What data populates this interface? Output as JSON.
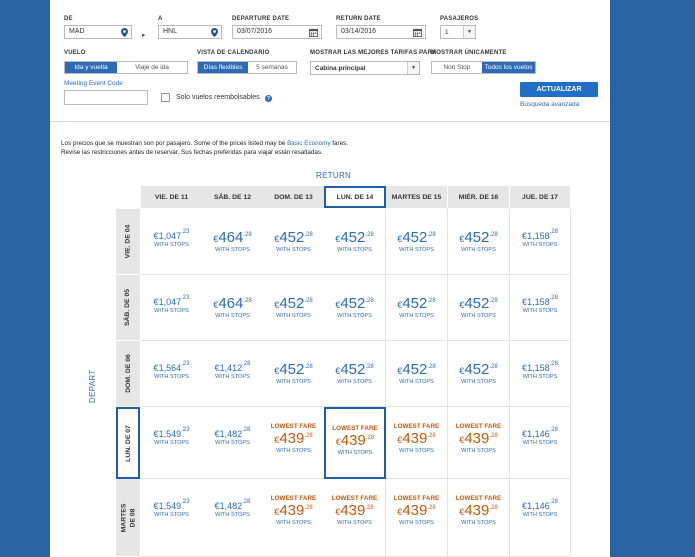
{
  "search": {
    "from_label": "DE",
    "from_value": "MAD",
    "to_label": "A",
    "to_value": "HNL",
    "depart_label": "DEPARTURE DATE",
    "depart_value": "03/07/2016",
    "return_label": "RETURN DATE",
    "return_value": "03/14/2016",
    "pax_label": "PASAJEROS",
    "pax_value": "1",
    "flight_label": "VUELO",
    "flight_opt1": "Ida y vuelta",
    "flight_opt2": "Viaje de ida",
    "calview_label": "VISTA DE CALENDARIO",
    "calview_opt1": "Días flexibles",
    "calview_opt2": "5 semanas",
    "fares_label": "MOSTRAR LAS MEJORES TARIFAS PARA",
    "fares_value": "Cabina principal",
    "show_label": "MOSTRAR ÚNICAMENTE",
    "show_opt1": "Non Stop",
    "show_opt2": "Todos los vuelos",
    "meeting_link": "Meeting Event Code",
    "refundable_label": "Solo vuelos reembolsables",
    "update_button": "ACTUALIZAR",
    "advanced_link": "Búsqueda avanzada"
  },
  "notice": {
    "line1_a": "Los precios que se muestran son por pasajero. Some of the prices listed may be ",
    "line1_link": "Basic Economy",
    "line1_b": " fares.",
    "line2": "Revise las restricciones antes de reservar. Sus fechas preferidas para viajar están resaltadas."
  },
  "grid": {
    "return_axis": "RETURN",
    "depart_axis": "DEPART",
    "stops_text": "WITH STOPS",
    "lowest_text": "LOWEST FARE",
    "currency": "€",
    "return_dates": [
      "VIE. DE 11",
      "SÁB. DE 12",
      "DOM. DE 13",
      "LUN. DE 14",
      "MARTES DE 15",
      "MIÉR. DE 16",
      "JUE. DE 17"
    ],
    "depart_dates": [
      "VIE. DE 04",
      "SÁB. DE 05",
      "DOM. DE 06",
      "LUN. DE 07",
      "MARTES DE 08"
    ],
    "rows": [
      [
        {
          "w": "1,047",
          "c": "23"
        },
        {
          "w": "464",
          "c": "28"
        },
        {
          "w": "452",
          "c": "28"
        },
        {
          "w": "452",
          "c": "28"
        },
        {
          "w": "452",
          "c": "28"
        },
        {
          "w": "452",
          "c": "28"
        },
        {
          "w": "1,158",
          "c": "28"
        }
      ],
      [
        {
          "w": "1,047",
          "c": "23"
        },
        {
          "w": "464",
          "c": "28"
        },
        {
          "w": "452",
          "c": "28"
        },
        {
          "w": "452",
          "c": "28"
        },
        {
          "w": "452",
          "c": "28"
        },
        {
          "w": "452",
          "c": "28"
        },
        {
          "w": "1,158",
          "c": "28"
        }
      ],
      [
        {
          "w": "1,564",
          "c": "23"
        },
        {
          "w": "1,412",
          "c": "28"
        },
        {
          "w": "452",
          "c": "28"
        },
        {
          "w": "452",
          "c": "28"
        },
        {
          "w": "452",
          "c": "28"
        },
        {
          "w": "452",
          "c": "28"
        },
        {
          "w": "1,158",
          "c": "28"
        }
      ],
      [
        {
          "w": "1,549",
          "c": "23"
        },
        {
          "w": "1,482",
          "c": "28"
        },
        {
          "w": "439",
          "c": "28",
          "low": true
        },
        {
          "w": "439",
          "c": "28",
          "low": true
        },
        {
          "w": "439",
          "c": "28",
          "low": true
        },
        {
          "w": "439",
          "c": "28",
          "low": true
        },
        {
          "w": "1,146",
          "c": "28"
        }
      ],
      [
        {
          "w": "1,549",
          "c": "23"
        },
        {
          "w": "1,482",
          "c": "28"
        },
        {
          "w": "439",
          "c": "28",
          "low": true
        },
        {
          "w": "439",
          "c": "28",
          "low": true
        },
        {
          "w": "439",
          "c": "28",
          "low": true
        },
        {
          "w": "439",
          "c": "28",
          "low": true
        },
        {
          "w": "1,146",
          "c": "28"
        }
      ]
    ]
  },
  "colors": {
    "brand": "#2c6bb8",
    "lowest": "#c15a10",
    "background": "#2a63a3"
  },
  "icons": {
    "location": "location-pin-icon",
    "calendar": "calendar-icon",
    "help": "help-icon"
  }
}
